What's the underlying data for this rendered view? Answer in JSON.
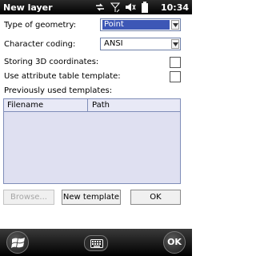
{
  "window": {
    "title": "New layer",
    "clock": "10:34"
  },
  "status_icons": [
    "network-sync-icon",
    "signal-icon",
    "volume-mute-icon",
    "battery-icon"
  ],
  "form": {
    "geometry_label": "Type of geometry:",
    "geometry_value": "Point",
    "coding_label": "Character coding:",
    "coding_value": "ANSI",
    "store3d_label": "Storing 3D coordinates:",
    "store3d_checked": false,
    "attr_template_label": "Use attribute table template:",
    "attr_template_checked": false,
    "templates_label": "Previously used templates:"
  },
  "templates_table": {
    "columns": [
      "Filename",
      "Path"
    ],
    "rows": []
  },
  "buttons": {
    "browse": "Browse...",
    "new_template": "New template",
    "ok": "OK"
  },
  "softbar": {
    "ok_label": "OK"
  },
  "colors": {
    "selection": "#3d57b6",
    "list_bg": "#dfe0f1",
    "border": "#7f8db8"
  }
}
